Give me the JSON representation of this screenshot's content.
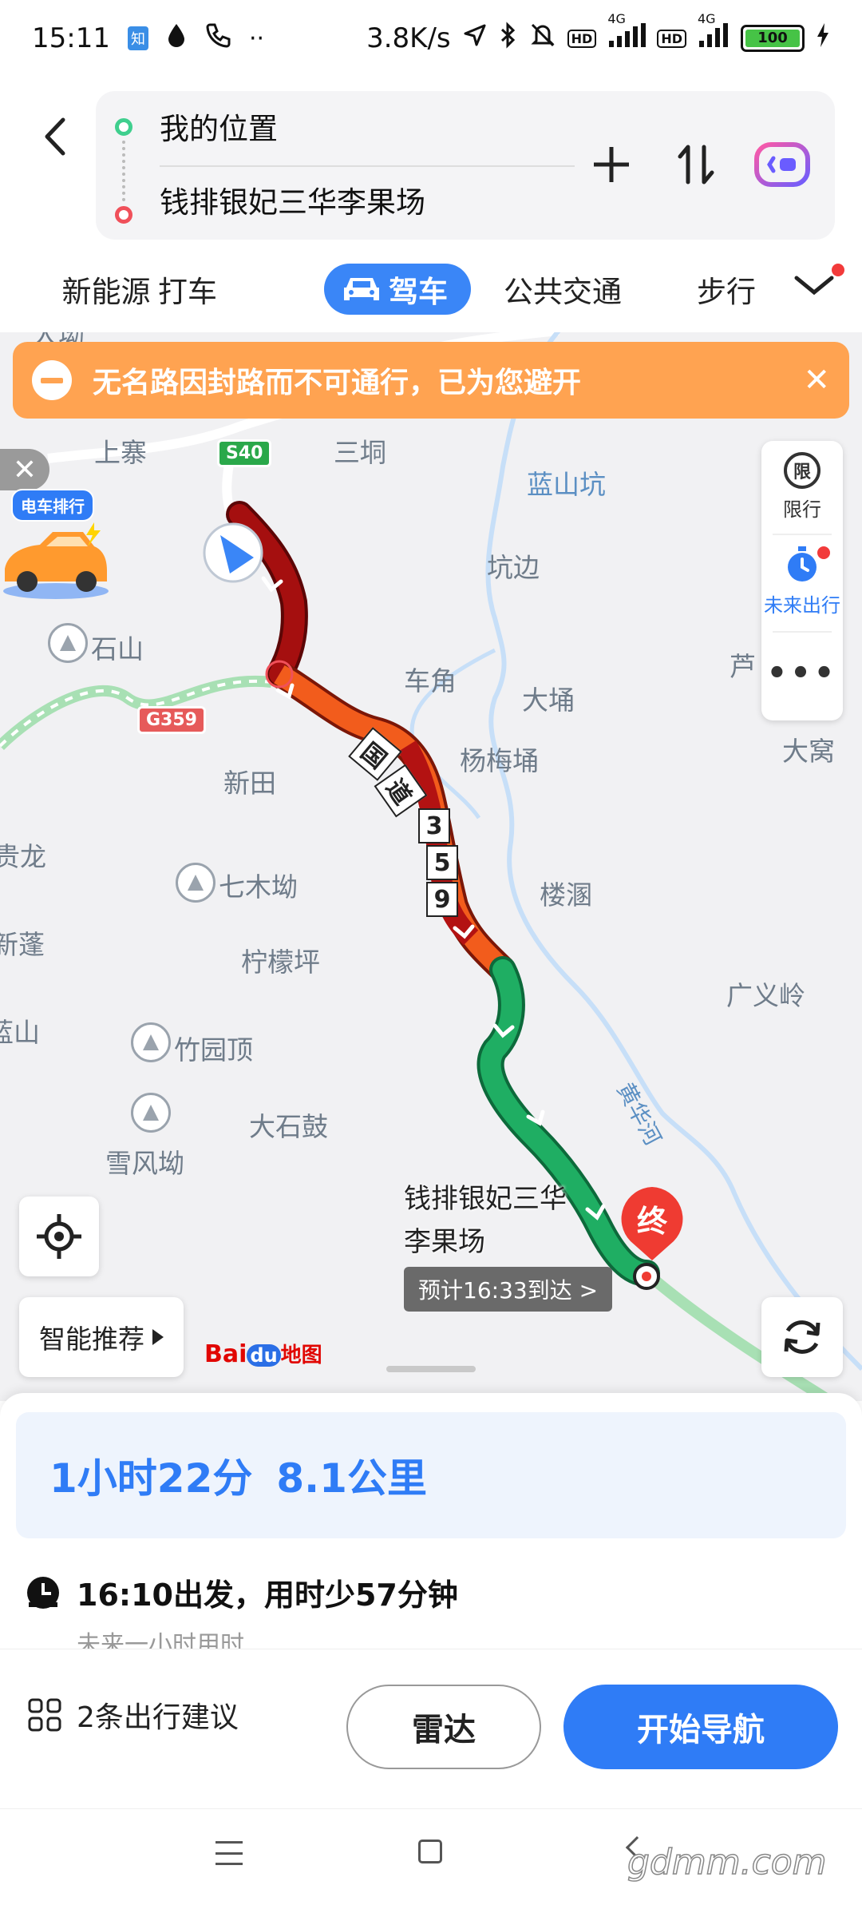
{
  "status_bar": {
    "time": "15:11",
    "app_badge": "知",
    "net_speed": "3.8K/s",
    "hd1": "HD",
    "hd2": "HD",
    "sig1": "4G",
    "sig2": "4G",
    "battery": "100"
  },
  "route": {
    "from": "我的位置",
    "to": "钱排银妃三华李果场"
  },
  "modes": [
    {
      "label": "新能源",
      "active": false
    },
    {
      "label": "打车",
      "active": false
    },
    {
      "label": "驾车",
      "active": true
    },
    {
      "label": "公共交通",
      "active": false
    },
    {
      "label": "步行",
      "active": false
    }
  ],
  "alert": {
    "text": "无名路因封路而不可通行，已为您避开"
  },
  "promo": {
    "tag": "电车排行"
  },
  "side_panel": {
    "limit_icon": "限",
    "limit_label": "限行",
    "future_label": "未来出行"
  },
  "map_labels": [
    {
      "text": "大坳"
    },
    {
      "text": "上寨"
    },
    {
      "text": "三垌"
    },
    {
      "text": "蓝山坑"
    },
    {
      "text": "坑边"
    },
    {
      "text": "石山"
    },
    {
      "text": "车角"
    },
    {
      "text": "大埇"
    },
    {
      "text": "芦"
    },
    {
      "text": "杨梅埇"
    },
    {
      "text": "大窝"
    },
    {
      "text": "新田"
    },
    {
      "text": "贵龙"
    },
    {
      "text": "七木坳"
    },
    {
      "text": "楼溷"
    },
    {
      "text": "新蓬"
    },
    {
      "text": "柠檬坪"
    },
    {
      "text": "广义岭"
    },
    {
      "text": "蓝山"
    },
    {
      "text": "竹园顶"
    },
    {
      "text": "大石鼓"
    },
    {
      "text": "雪风坳"
    }
  ],
  "river_label": "黄华河",
  "shields": {
    "s40": "S40",
    "g359": "G359"
  },
  "route_road_label": "国道359",
  "route_road_chars": [
    "国",
    "道",
    "3",
    "5",
    "9"
  ],
  "destination": {
    "name": "钱排银妃三华李果场",
    "eta": "预计16:33到达 >",
    "pin": "终"
  },
  "controls": {
    "smart": "智能推荐",
    "baidu_a": "Bai",
    "baidu_b": "du",
    "baidu_c": "地图"
  },
  "summary": {
    "duration": "1小时22分",
    "distance": "8.1公里"
  },
  "departure": {
    "text": "16:10出发，用时少57分钟",
    "sub": "未来一小时用时"
  },
  "actions": {
    "suggest": "2条出行建议",
    "radar": "雷达",
    "navigate": "开始导航"
  },
  "watermark": "gdmm.com",
  "colors": {
    "accent": "#2f7cf6",
    "alert": "#ffa351",
    "traffic_jam": "#a50f0f",
    "traffic_slow": "#f25c1c",
    "traffic_ok": "#1fae63"
  }
}
